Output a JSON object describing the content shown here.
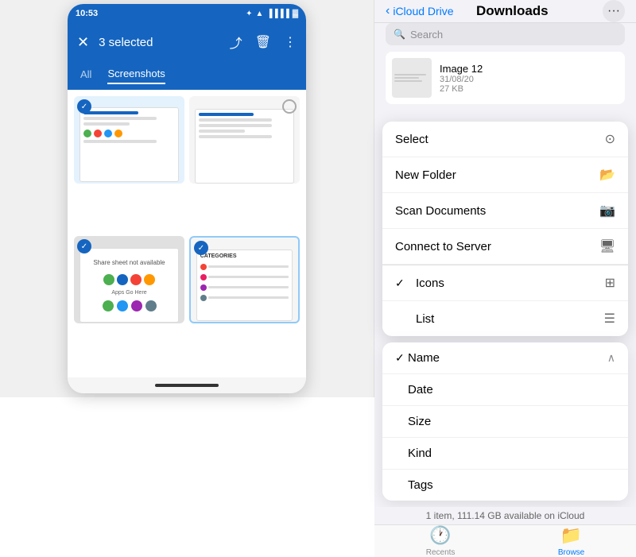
{
  "phone": {
    "status_time": "10:53",
    "toolbar_title": "3 selected",
    "tabs": [
      {
        "label": "All",
        "active": false
      },
      {
        "label": "Screenshots",
        "active": true
      }
    ],
    "screenshots": [
      {
        "id": 1,
        "selected": true,
        "type": "blue"
      },
      {
        "id": 2,
        "selected": false,
        "type": "gray"
      },
      {
        "id": 3,
        "selected": true,
        "type": "gray"
      },
      {
        "id": 4,
        "selected": true,
        "type": "light"
      }
    ]
  },
  "ios": {
    "back_label": "iCloud Drive",
    "title": "Downloads",
    "search_placeholder": "Search",
    "file": {
      "name": "Image 12",
      "date": "31/08/20",
      "size": "27 KB"
    },
    "menu": {
      "items": [
        {
          "label": "Select",
          "icon": "⊙",
          "check": false
        },
        {
          "label": "New Folder",
          "icon": "🗂",
          "check": false
        },
        {
          "label": "Scan Documents",
          "icon": "📷",
          "check": false
        },
        {
          "label": "Connect to Server",
          "icon": "🖥",
          "check": false
        }
      ]
    },
    "view_options": [
      {
        "label": "Icons",
        "icon": "⊞",
        "checked": true
      },
      {
        "label": "List",
        "icon": "≡",
        "checked": false
      }
    ],
    "sort_options": [
      {
        "label": "Name",
        "checked": true,
        "has_arrow": true
      },
      {
        "label": "Date",
        "checked": false,
        "has_arrow": false
      },
      {
        "label": "Size",
        "checked": false,
        "has_arrow": false
      },
      {
        "label": "Kind",
        "checked": false,
        "has_arrow": false
      },
      {
        "label": "Tags",
        "checked": false,
        "has_arrow": false
      }
    ],
    "storage_info": "1 item, 111.14 GB available on iCloud",
    "bottom_tabs": [
      {
        "label": "Recents",
        "icon": "🕐",
        "active": false
      },
      {
        "label": "Browse",
        "icon": "📁",
        "active": true
      }
    ]
  }
}
